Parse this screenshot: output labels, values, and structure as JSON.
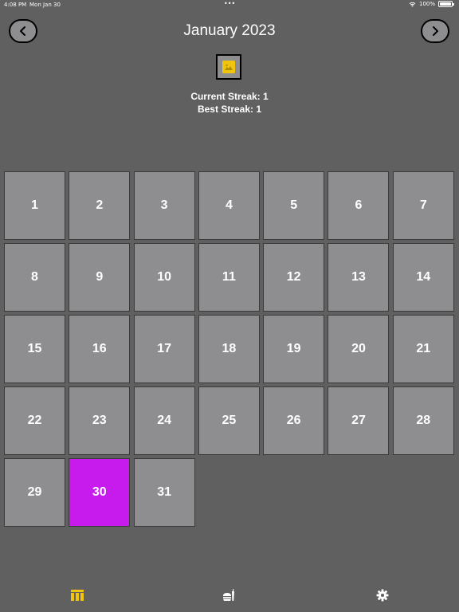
{
  "status_bar": {
    "time": "4:08 PM",
    "date": "Mon Jan 30",
    "dots": "•••",
    "battery": "100%"
  },
  "header": {
    "title": "January 2023",
    "prev_icon": "chevron-left-icon",
    "next_icon": "chevron-right-icon"
  },
  "thumbnail": {
    "icon": "image-icon",
    "color": "#f1c40f"
  },
  "streaks": {
    "current": "Current Streak: 1",
    "best": "Best Streak: 1"
  },
  "calendar": {
    "days": [
      "1",
      "2",
      "3",
      "4",
      "5",
      "6",
      "7",
      "8",
      "9",
      "10",
      "11",
      "12",
      "13",
      "14",
      "15",
      "16",
      "17",
      "18",
      "19",
      "20",
      "21",
      "22",
      "23",
      "24",
      "25",
      "26",
      "27",
      "28",
      "29",
      "30",
      "31"
    ],
    "selected_day": "30",
    "selected_color": "#c71aed",
    "cell_color": "#8e8d8f"
  },
  "tab_bar": {
    "active_color": "#f1c40f",
    "tabs": [
      {
        "icon": "calendar-icon",
        "active": true
      },
      {
        "icon": "food-icon",
        "active": false
      },
      {
        "icon": "gear-icon",
        "active": false
      }
    ]
  }
}
